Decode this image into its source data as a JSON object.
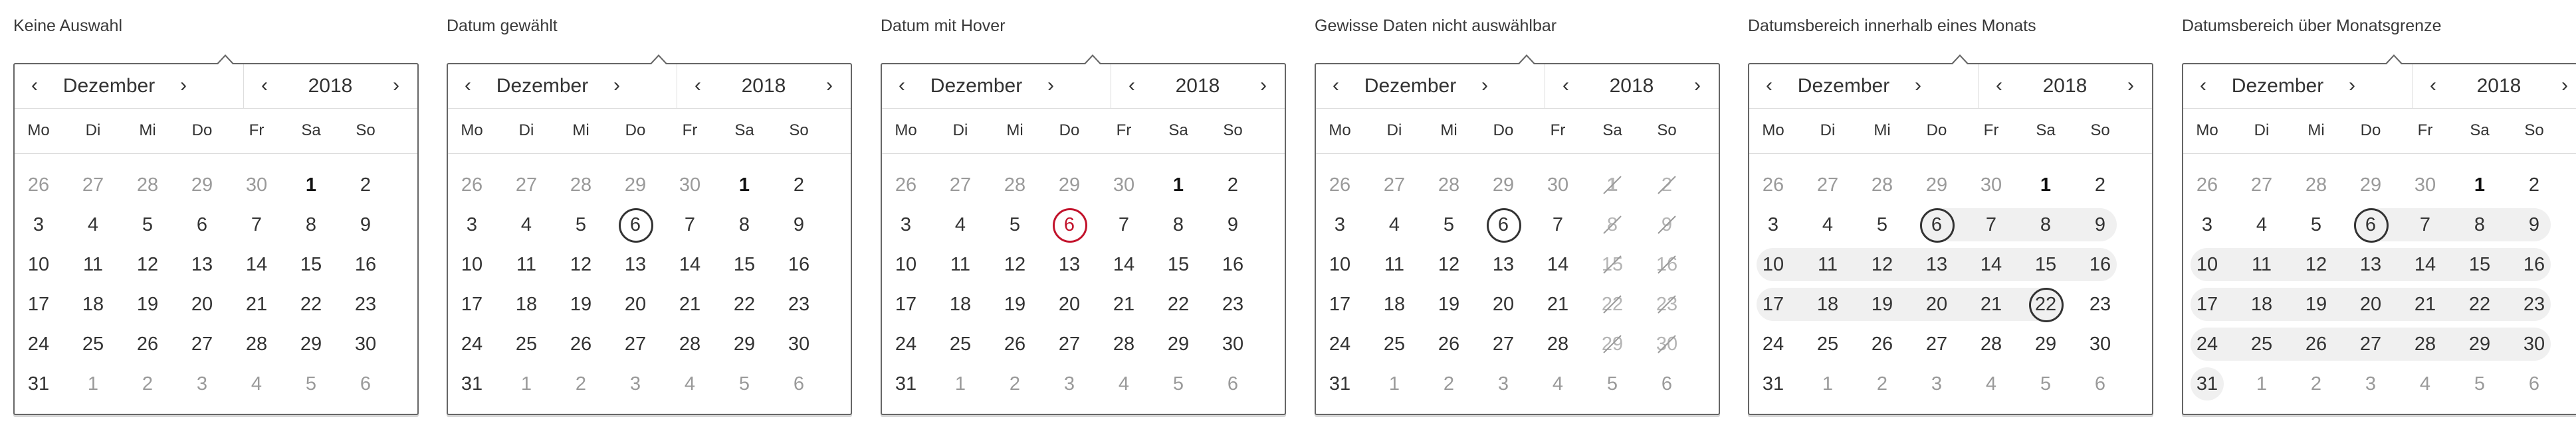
{
  "panels": [
    {
      "caption": "Keine Auswahl",
      "month": "Dezember",
      "year": "2018",
      "nav": {
        "prev": "‹",
        "next": "›"
      },
      "weekdays": [
        "Mo",
        "Di",
        "Mi",
        "Do",
        "Fr",
        "Sa",
        "So"
      ],
      "weeks": [
        [
          "26",
          "27",
          "28",
          "29",
          "30",
          "1",
          "2"
        ],
        [
          "3",
          "4",
          "5",
          "6",
          "7",
          "8",
          "9"
        ],
        [
          "10",
          "11",
          "12",
          "13",
          "14",
          "15",
          "16"
        ],
        [
          "17",
          "18",
          "19",
          "20",
          "21",
          "22",
          "23"
        ],
        [
          "24",
          "25",
          "26",
          "27",
          "28",
          "29",
          "30"
        ],
        [
          "31",
          "1",
          "2",
          "3",
          "4",
          "5",
          "6"
        ]
      ]
    },
    {
      "caption": "Datum gewählt",
      "month": "Dezember",
      "year": "2018",
      "nav": {
        "prev": "‹",
        "next": "›"
      },
      "weekdays": [
        "Mo",
        "Di",
        "Mi",
        "Do",
        "Fr",
        "Sa",
        "So"
      ],
      "weeks": [
        [
          "26",
          "27",
          "28",
          "29",
          "30",
          "1",
          "2"
        ],
        [
          "3",
          "4",
          "5",
          "6",
          "7",
          "8",
          "9"
        ],
        [
          "10",
          "11",
          "12",
          "13",
          "14",
          "15",
          "16"
        ],
        [
          "17",
          "18",
          "19",
          "20",
          "21",
          "22",
          "23"
        ],
        [
          "24",
          "25",
          "26",
          "27",
          "28",
          "29",
          "30"
        ],
        [
          "31",
          "1",
          "2",
          "3",
          "4",
          "5",
          "6"
        ]
      ],
      "selected": [
        "6"
      ]
    },
    {
      "caption": "Datum mit Hover",
      "month": "Dezember",
      "year": "2018",
      "nav": {
        "prev": "‹",
        "next": "›"
      },
      "weekdays": [
        "Mo",
        "Di",
        "Mi",
        "Do",
        "Fr",
        "Sa",
        "So"
      ],
      "weeks": [
        [
          "26",
          "27",
          "28",
          "29",
          "30",
          "1",
          "2"
        ],
        [
          "3",
          "4",
          "5",
          "6",
          "7",
          "8",
          "9"
        ],
        [
          "10",
          "11",
          "12",
          "13",
          "14",
          "15",
          "16"
        ],
        [
          "17",
          "18",
          "19",
          "20",
          "21",
          "22",
          "23"
        ],
        [
          "24",
          "25",
          "26",
          "27",
          "28",
          "29",
          "30"
        ],
        [
          "31",
          "1",
          "2",
          "3",
          "4",
          "5",
          "6"
        ]
      ],
      "hovered": "6",
      "hover_color": "#c2122b"
    },
    {
      "caption": "Gewisse Daten nicht auswählbar",
      "month": "Dezember",
      "year": "2018",
      "nav": {
        "prev": "‹",
        "next": "›"
      },
      "weekdays": [
        "Mo",
        "Di",
        "Mi",
        "Do",
        "Fr",
        "Sa",
        "So"
      ],
      "weeks": [
        [
          "26",
          "27",
          "28",
          "29",
          "30",
          "1",
          "2"
        ],
        [
          "3",
          "4",
          "5",
          "6",
          "7",
          "8",
          "9"
        ],
        [
          "10",
          "11",
          "12",
          "13",
          "14",
          "15",
          "16"
        ],
        [
          "17",
          "18",
          "19",
          "20",
          "21",
          "22",
          "23"
        ],
        [
          "24",
          "25",
          "26",
          "27",
          "28",
          "29",
          "30"
        ],
        [
          "31",
          "1",
          "2",
          "3",
          "4",
          "5",
          "6"
        ]
      ],
      "selected": [
        "6"
      ],
      "disabled": [
        "1",
        "2",
        "8",
        "9",
        "15",
        "16",
        "22",
        "23",
        "29",
        "30"
      ]
    },
    {
      "caption": "Datumsbereich innerhalb eines Monats",
      "month": "Dezember",
      "year": "2018",
      "nav": {
        "prev": "‹",
        "next": "›"
      },
      "weekdays": [
        "Mo",
        "Di",
        "Mi",
        "Do",
        "Fr",
        "Sa",
        "So"
      ],
      "weeks": [
        [
          "26",
          "27",
          "28",
          "29",
          "30",
          "1",
          "2"
        ],
        [
          "3",
          "4",
          "5",
          "6",
          "7",
          "8",
          "9"
        ],
        [
          "10",
          "11",
          "12",
          "13",
          "14",
          "15",
          "16"
        ],
        [
          "17",
          "18",
          "19",
          "20",
          "21",
          "22",
          "23"
        ],
        [
          "24",
          "25",
          "26",
          "27",
          "28",
          "29",
          "30"
        ],
        [
          "31",
          "1",
          "2",
          "3",
          "4",
          "5",
          "6"
        ]
      ],
      "range": {
        "start": "6",
        "end": "22"
      }
    },
    {
      "caption": "Datumsbereich über Monatsgrenze",
      "month": "Dezember",
      "year": "2018",
      "nav": {
        "prev": "‹",
        "next": "›"
      },
      "weekdays": [
        "Mo",
        "Di",
        "Mi",
        "Do",
        "Fr",
        "Sa",
        "So"
      ],
      "weeks": [
        [
          "26",
          "27",
          "28",
          "29",
          "30",
          "1",
          "2"
        ],
        [
          "3",
          "4",
          "5",
          "6",
          "7",
          "8",
          "9"
        ],
        [
          "10",
          "11",
          "12",
          "13",
          "14",
          "15",
          "16"
        ],
        [
          "17",
          "18",
          "19",
          "20",
          "21",
          "22",
          "23"
        ],
        [
          "24",
          "25",
          "26",
          "27",
          "28",
          "29",
          "30"
        ],
        [
          "31",
          "1",
          "2",
          "3",
          "4",
          "5",
          "6"
        ]
      ],
      "range": {
        "start": "6",
        "end": "31",
        "continues": true
      }
    }
  ],
  "colors": {
    "border": "#666666",
    "text": "#333333",
    "muted": "#9a9a9a",
    "range": "#f0f0f0",
    "hover": "#c2122b"
  },
  "icons": {
    "prev": "chevron-left-icon",
    "next": "chevron-right-icon",
    "unavailable": "strike-through-icon"
  }
}
